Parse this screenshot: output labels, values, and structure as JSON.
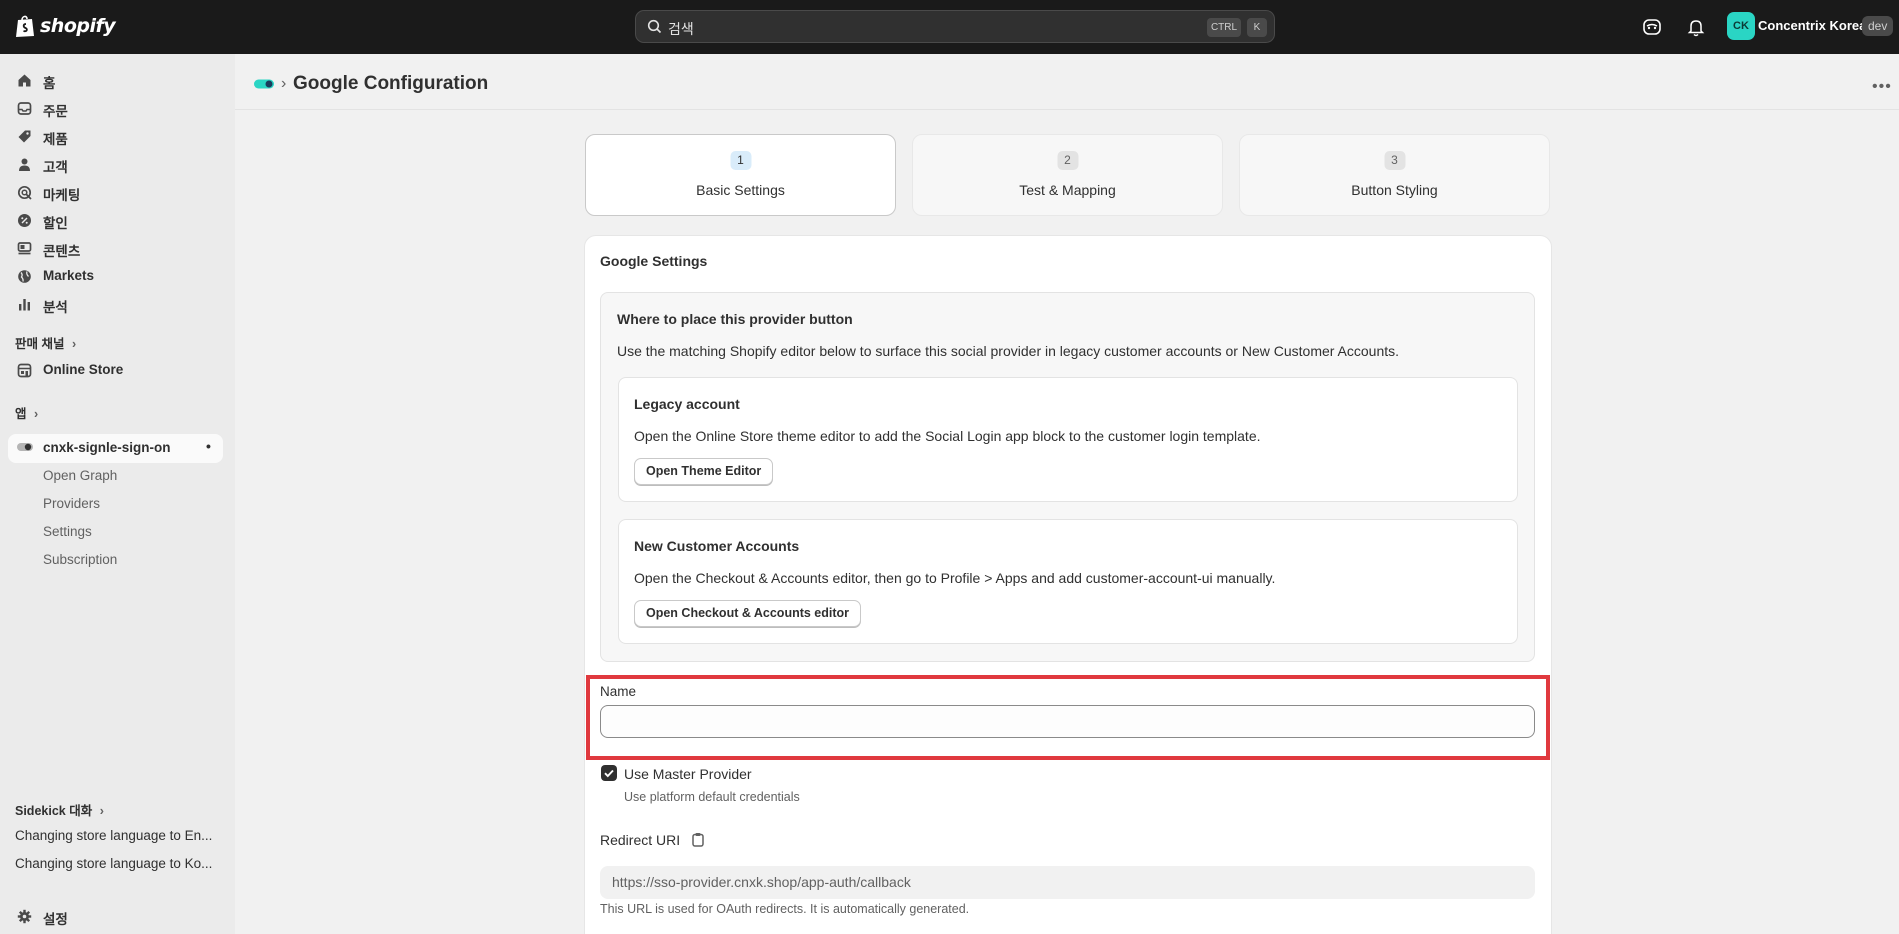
{
  "topbar": {
    "brand": "shopify",
    "search_placeholder": "검색",
    "shortcut_ctrl": "CTRL",
    "shortcut_k": "K",
    "avatar_initials": "CK",
    "store_name": "Concentrix Korea",
    "env_badge": "dev"
  },
  "sidebar": {
    "items": [
      {
        "label": "홈",
        "icon": "home-icon"
      },
      {
        "label": "주문",
        "icon": "inbox-icon"
      },
      {
        "label": "제품",
        "icon": "tag-icon"
      },
      {
        "label": "고객",
        "icon": "person-icon"
      },
      {
        "label": "마케팅",
        "icon": "target-icon"
      },
      {
        "label": "할인",
        "icon": "discount-icon"
      },
      {
        "label": "콘텐츠",
        "icon": "content-icon"
      },
      {
        "label": "Markets",
        "icon": "globe-icon"
      },
      {
        "label": "분석",
        "icon": "chart-icon"
      }
    ],
    "sales_channels_heading": "판매 채널",
    "online_store": "Online Store",
    "apps_heading": "앱",
    "active_app": "cnxk-signle-sign-on",
    "app_subitems": [
      "Open Graph",
      "Providers",
      "Settings",
      "Subscription"
    ],
    "sidekick_heading": "Sidekick 대화",
    "sidekick_items": [
      "Changing store language to En...",
      "Changing store language to Ko..."
    ],
    "settings": "설정"
  },
  "header": {
    "title": "Google Configuration"
  },
  "steps": [
    {
      "number": "1",
      "label": "Basic Settings"
    },
    {
      "number": "2",
      "label": "Test & Mapping"
    },
    {
      "number": "3",
      "label": "Button Styling"
    }
  ],
  "card": {
    "title": "Google Settings",
    "placement": {
      "title": "Where to place this provider button",
      "description": "Use the matching Shopify editor below to surface this social provider in legacy customer accounts or New Customer Accounts.",
      "legacy": {
        "title": "Legacy account",
        "description": "Open the Online Store theme editor to add the Social Login app block to the customer login template.",
        "button": "Open Theme Editor"
      },
      "new_accounts": {
        "title": "New Customer Accounts",
        "description": "Open the Checkout & Accounts editor, then go to Profile > Apps and add customer-account-ui manually.",
        "button": "Open Checkout & Accounts editor"
      }
    },
    "name_label": "Name",
    "name_value": "",
    "use_master_label": "Use Master Provider",
    "use_master_help": "Use platform default credentials",
    "use_master_checked": true,
    "redirect_label": "Redirect URI",
    "redirect_value": "https://sso-provider.cnxk.shop/app-auth/callback",
    "redirect_help": "This URL is used for OAuth redirects. It is automatically generated."
  },
  "colors": {
    "topbar_bg": "#1a1a1a",
    "avatar_bg": "#2ad5c4",
    "highlight_border": "#e0393e",
    "sidebar_bg": "#ebebeb"
  }
}
